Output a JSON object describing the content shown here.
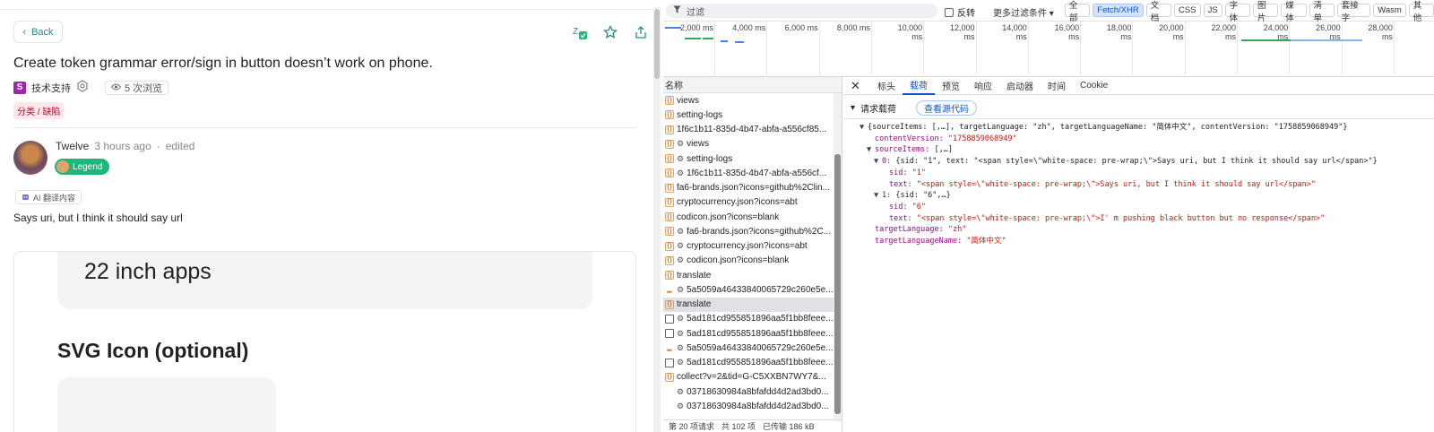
{
  "forum": {
    "back_label": "Back",
    "title": "Create token grammar error/sign in button doesn’t work on phone.",
    "category_letter": "S",
    "category": "技术支持",
    "views": "5 次浏览",
    "tag": "分类 / 缺陷",
    "author": "Twelve",
    "time": "3 hours ago",
    "edited": "edited",
    "badge": "Legend",
    "ai_chip": "AI 翻译内容",
    "body": "Says uri, but I think it should say url",
    "card_heading": "22 inch apps",
    "card_subheading": "SVG Icon (optional)"
  },
  "devtools": {
    "filter_placeholder": "过滤",
    "invert_label": "反转",
    "more_filters": "更多过滤条件 ▾",
    "type_filters": [
      {
        "label": "全部",
        "active": false
      },
      {
        "label": "Fetch/XHR",
        "active": true
      },
      {
        "label": "文档",
        "active": false
      },
      {
        "label": "CSS",
        "active": false
      },
      {
        "label": "JS",
        "active": false
      },
      {
        "label": "字体",
        "active": false
      },
      {
        "label": "图片",
        "active": false
      },
      {
        "label": "媒体",
        "active": false
      },
      {
        "label": "清单",
        "active": false
      },
      {
        "label": "套接字",
        "active": false
      },
      {
        "label": "Wasm",
        "active": false
      },
      {
        "label": "其他",
        "active": false
      }
    ],
    "timeline_ticks": [
      "2,000 ms",
      "4,000 ms",
      "6,000 ms",
      "8,000 ms",
      "10,000 ms",
      "12,000 ms",
      "14,000 ms",
      "16,000 ms",
      "18,000 ms",
      "20,000 ms",
      "22,000 ms",
      "24,000 ms",
      "26,000 ms",
      "28,000 ms"
    ],
    "list_header": "名称",
    "requests": [
      {
        "icon": "xhr",
        "gear": false,
        "name": "views",
        "selected": false
      },
      {
        "icon": "xhr",
        "gear": false,
        "name": "setting-logs",
        "selected": false
      },
      {
        "icon": "xhr",
        "gear": false,
        "name": "1f6c1b11-835d-4b47-abfa-a556cf85...",
        "selected": false
      },
      {
        "icon": "xhr",
        "gear": true,
        "name": "views",
        "selected": false
      },
      {
        "icon": "xhr",
        "gear": true,
        "name": "setting-logs",
        "selected": false
      },
      {
        "icon": "xhr",
        "gear": true,
        "name": "1f6c1b11-835d-4b47-abfa-a556cf...",
        "selected": false
      },
      {
        "icon": "xhr",
        "gear": false,
        "name": "fa6-brands.json?icons=github%2Clin...",
        "selected": false
      },
      {
        "icon": "xhr",
        "gear": false,
        "name": "cryptocurrency.json?icons=abt",
        "selected": false
      },
      {
        "icon": "xhr",
        "gear": false,
        "name": "codicon.json?icons=blank",
        "selected": false
      },
      {
        "icon": "xhr",
        "gear": true,
        "name": "fa6-brands.json?icons=github%2C...",
        "selected": false
      },
      {
        "icon": "xhr",
        "gear": true,
        "name": "cryptocurrency.json?icons=abt",
        "selected": false
      },
      {
        "icon": "xhr",
        "gear": true,
        "name": "codicon.json?icons=blank",
        "selected": false
      },
      {
        "icon": "xhr",
        "gear": false,
        "name": "translate",
        "selected": false
      },
      {
        "icon": "img",
        "gear": true,
        "name": "5a5059a46433840065729c260e5e...",
        "selected": false
      },
      {
        "icon": "xhr",
        "gear": false,
        "name": "translate",
        "selected": true
      },
      {
        "icon": "doc",
        "gear": true,
        "name": "5ad181cd955851896aa5f1bb8feee...",
        "selected": false
      },
      {
        "icon": "doc",
        "gear": true,
        "name": "5ad181cd955851896aa5f1bb8feee...",
        "selected": false
      },
      {
        "icon": "img",
        "gear": true,
        "name": "5a5059a46433840065729c260e5e...",
        "selected": false
      },
      {
        "icon": "doc",
        "gear": true,
        "name": "5ad181cd955851896aa5f1bb8feee...",
        "selected": false
      },
      {
        "icon": "xhr",
        "gear": false,
        "name": "collect?v=2&tid=G-C5XXBN7WY7&...",
        "selected": false
      },
      {
        "icon": "none",
        "gear": true,
        "name": "03718630984a8bfafdd4d2ad3bd0...",
        "selected": false
      },
      {
        "icon": "none",
        "gear": true,
        "name": "03718630984a8bfafdd4d2ad3bd0...",
        "selected": false
      }
    ],
    "status_bar": [
      "第 20 项请求",
      "共 102 项",
      "已传输 186 kB"
    ],
    "tabs": [
      {
        "label": "标头",
        "active": false
      },
      {
        "label": "载荷",
        "active": true
      },
      {
        "label": "预览",
        "active": false
      },
      {
        "label": "响应",
        "active": false
      },
      {
        "label": "启动器",
        "active": false
      },
      {
        "label": "时间",
        "active": false
      },
      {
        "label": "Cookie",
        "active": false
      }
    ],
    "payload_label": "请求载荷",
    "view_source": "查看源代码",
    "payload_tree": [
      {
        "indent": 0,
        "tri": "▼",
        "parts": [
          [
            "p",
            "{sourceItems: [,…], targetLanguage: \"zh\", targetLanguageName: \"简体中文\", contentVersion: \"1758859068949\"}"
          ]
        ]
      },
      {
        "indent": 1,
        "tri": "",
        "parts": [
          [
            "k",
            "contentVersion: "
          ],
          [
            "s",
            "\"1758859068949\""
          ]
        ]
      },
      {
        "indent": 1,
        "tri": "▼",
        "parts": [
          [
            "k",
            "sourceItems: "
          ],
          [
            "p",
            "[,…]"
          ]
        ]
      },
      {
        "indent": 2,
        "tri": "▼",
        "parts": [
          [
            "k",
            "0: "
          ],
          [
            "p",
            "{sid: \"1\", text: \"<span style=\\\"white-space: pre-wrap;\\\">Says uri, but I think it should say url</span>\"}"
          ]
        ]
      },
      {
        "indent": 3,
        "tri": "",
        "parts": [
          [
            "k",
            "sid: "
          ],
          [
            "s",
            "\"1\""
          ]
        ]
      },
      {
        "indent": 3,
        "tri": "",
        "parts": [
          [
            "k",
            "text: "
          ],
          [
            "s",
            "\"<span style=\\\"white-space: pre-wrap;\\\">Says uri, but I think it should say url</span>\""
          ]
        ]
      },
      {
        "indent": 2,
        "tri": "▼",
        "parts": [
          [
            "k",
            "1: "
          ],
          [
            "p",
            "{sid: \"6\",…}"
          ]
        ]
      },
      {
        "indent": 3,
        "tri": "",
        "parts": [
          [
            "k",
            "sid: "
          ],
          [
            "s",
            "\"6\""
          ]
        ]
      },
      {
        "indent": 3,
        "tri": "",
        "parts": [
          [
            "k",
            "text: "
          ],
          [
            "s",
            "\"<span style=\\\"white-space: pre-wrap;\\\">I' m pushing black button but no response</span>\""
          ]
        ]
      },
      {
        "indent": 1,
        "tri": "",
        "parts": [
          [
            "k",
            "targetLanguage: "
          ],
          [
            "s",
            "\"zh\""
          ]
        ]
      },
      {
        "indent": 1,
        "tri": "",
        "parts": [
          [
            "k",
            "targetLanguageName: "
          ],
          [
            "s",
            "\"简体中文\""
          ]
        ]
      }
    ]
  }
}
